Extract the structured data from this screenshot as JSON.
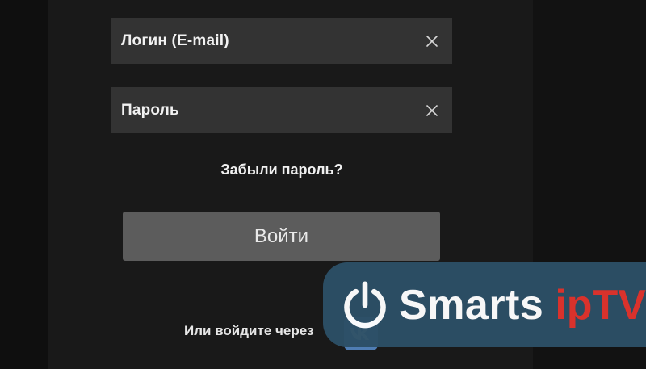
{
  "login_form": {
    "login_field": {
      "label": "Логин (E-mail)",
      "clear_icon": "close-icon"
    },
    "password_field": {
      "label": "Пароль",
      "clear_icon": "close-icon"
    },
    "forgot_password": "Забыли пароль?",
    "submit_label": "Войти",
    "social_prompt": "Или войдите через",
    "social_vk": "vk-logo-icon"
  },
  "brand": {
    "icon": "power-icon",
    "name_part1": "Smarts",
    "name_part2": "ipTV",
    "colors": {
      "badge_bg": "#2c4f66",
      "accent": "#e0342d",
      "text": "#ffffff"
    }
  },
  "colors": {
    "background": "#141414",
    "field_bg": "#333333",
    "button_bg": "#5c5c5c",
    "vk_blue": "#4f7db3"
  }
}
